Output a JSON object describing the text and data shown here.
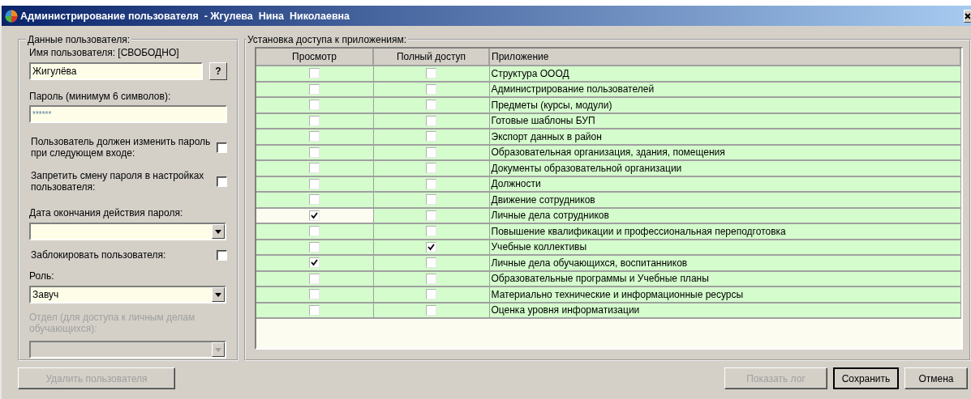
{
  "window": {
    "title": "Администрирование пользователя  - Жгулева  Нина  Николаевна"
  },
  "user_data": {
    "legend": "Данные пользователя:",
    "username_label": "Имя пользователя: [СВОБОДНО]",
    "username": "Жигулёва",
    "help_button": "?",
    "password_label": "Пароль (минимум 6 символов):",
    "password": "******",
    "options": [
      {
        "label": "Пользователь должен изменить пароль при следующем входе:",
        "checked": false
      },
      {
        "label": "Запретить смену пароля в настройках пользователя:",
        "checked": false
      }
    ],
    "expiry_label": "Дата окончания действия пароля:",
    "block": {
      "label": "Заблокировать пользователя:",
      "checked": false
    },
    "role_label": "Роль:",
    "role": "Завуч",
    "department": {
      "label": "Отдел (для доступа к личным делам обучающихся):",
      "disabled": true
    }
  },
  "delete_button": {
    "label": "Удалить пользователя",
    "disabled": true
  },
  "access": {
    "legend": "Установка доступа к приложениям:",
    "columns": [
      "Просмотр",
      "Полный доступ",
      "Приложение"
    ],
    "rows": [
      {
        "view": false,
        "full": false,
        "app": "Структура ОООД",
        "selected": false
      },
      {
        "view": false,
        "full": false,
        "app": "Администрирование пользователей",
        "selected": false
      },
      {
        "view": false,
        "full": false,
        "app": "Предметы (курсы, модули)",
        "selected": false
      },
      {
        "view": false,
        "full": false,
        "app": "Готовые шаблоны БУП",
        "selected": false
      },
      {
        "view": false,
        "full": false,
        "app": "Экспорт данных в район",
        "selected": false
      },
      {
        "view": false,
        "full": false,
        "app": "Образовательная организация, здания, помещения",
        "selected": false
      },
      {
        "view": false,
        "full": false,
        "app": "Документы образовательной организации",
        "selected": false
      },
      {
        "view": false,
        "full": false,
        "app": "Должности",
        "selected": false
      },
      {
        "view": false,
        "full": false,
        "app": "Движение сотрудников",
        "selected": false
      },
      {
        "view": true,
        "full": false,
        "app": "Личные дела сотрудников",
        "selected": true
      },
      {
        "view": false,
        "full": false,
        "app": "Повышение квалификации и профессиональная переподготовка",
        "selected": false
      },
      {
        "view": false,
        "full": true,
        "app": "Учебные коллективы",
        "selected": false
      },
      {
        "view": true,
        "full": false,
        "app": "Личные дела обучающихся, воспитанников",
        "selected": false
      },
      {
        "view": false,
        "full": false,
        "app": "Образовательные программы и Учебные планы",
        "selected": false
      },
      {
        "view": false,
        "full": false,
        "app": "Материально технические и информационные ресурсы",
        "selected": false
      },
      {
        "view": false,
        "full": false,
        "app": "Оценка уровня информатизации",
        "selected": false
      }
    ]
  },
  "buttons": [
    {
      "label": "Показать лог",
      "disabled": true,
      "default": false
    },
    {
      "label": "Сохранить",
      "disabled": false,
      "default": true
    },
    {
      "label": "Отмена",
      "disabled": false,
      "default": false
    }
  ]
}
